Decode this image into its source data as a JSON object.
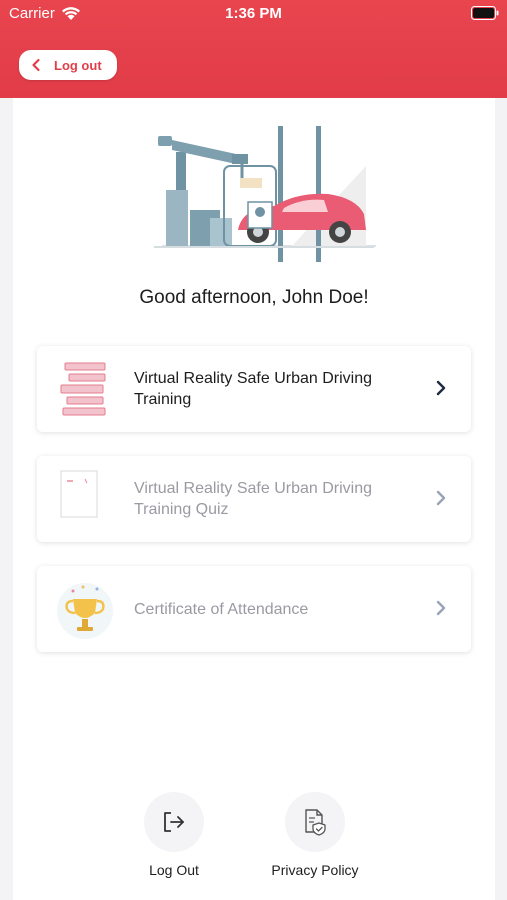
{
  "status_bar": {
    "carrier": "Carrier",
    "time": "1:36 PM",
    "wifi_icon": "wifi-icon",
    "battery_icon": "battery-icon"
  },
  "header": {
    "back_label": "Log out",
    "back_icon": "chevron-left-icon",
    "background_color": "#e3404b"
  },
  "greeting": "Good afternoon, John Doe!",
  "cards": [
    {
      "title": "Virtual Reality Safe Urban Driving Training",
      "enabled": true,
      "icon": "books-icon"
    },
    {
      "title": "Virtual Reality Safe Urban Driving Training Quiz",
      "enabled": false,
      "icon": "quiz-document-icon"
    },
    {
      "title": "Certificate of Attendance",
      "enabled": false,
      "icon": "trophy-icon"
    }
  ],
  "footer": {
    "logout_label": "Log Out",
    "privacy_label": "Privacy Policy"
  },
  "colors": {
    "accent": "#e3404b",
    "text": "#1d1d1d",
    "disabled_text": "#9a9aa2"
  }
}
